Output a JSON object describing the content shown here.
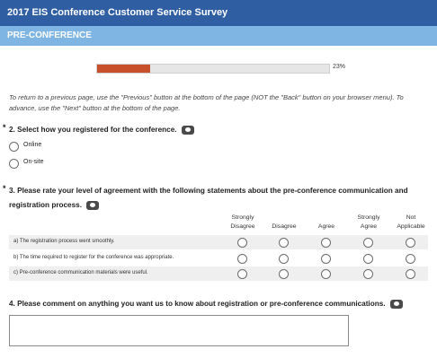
{
  "header": {
    "title": "2017 EIS Conference Customer Service Survey"
  },
  "section": {
    "title": "PRE-CONFERENCE"
  },
  "progress": {
    "value": 0.23,
    "label": "23%"
  },
  "intro": "To return to a previous page, use the \"Previous\" button at the bottom of the page (NOT the \"Back\" button on your browser menu). To advance, use the \"Next\" button at the bottom of the page.",
  "q2": {
    "required": "*",
    "title": "2. Select how you registered for the conference.",
    "options": [
      "Online",
      "On-site"
    ]
  },
  "q3": {
    "required": "*",
    "title_line1": "3. Please rate your level of agreement with the following statements about the pre-conference communication and",
    "title_line2": "registration process.",
    "columns": [
      {
        "line1": "Strongly",
        "line2": "Disagree"
      },
      {
        "line1": "",
        "line2": "Disagree"
      },
      {
        "line1": "",
        "line2": "Agree"
      },
      {
        "line1": "Strongly",
        "line2": "Agree"
      },
      {
        "line1": "Not",
        "line2": "Applicable"
      }
    ],
    "rows": [
      "a) The registration process went smoothly.",
      "b) The time required to register for the conference was appropriate.",
      "c) Pre-conference communication materials were useful."
    ]
  },
  "q4": {
    "title": "4. Please comment on anything you want us to know about registration or pre-conference communications."
  },
  "icons": {
    "comment": "comment-bubble-icon"
  },
  "colors": {
    "header_bg": "#2f5ea3",
    "section_bg": "#7fb5e3",
    "progress_fill": "#c8502a"
  }
}
